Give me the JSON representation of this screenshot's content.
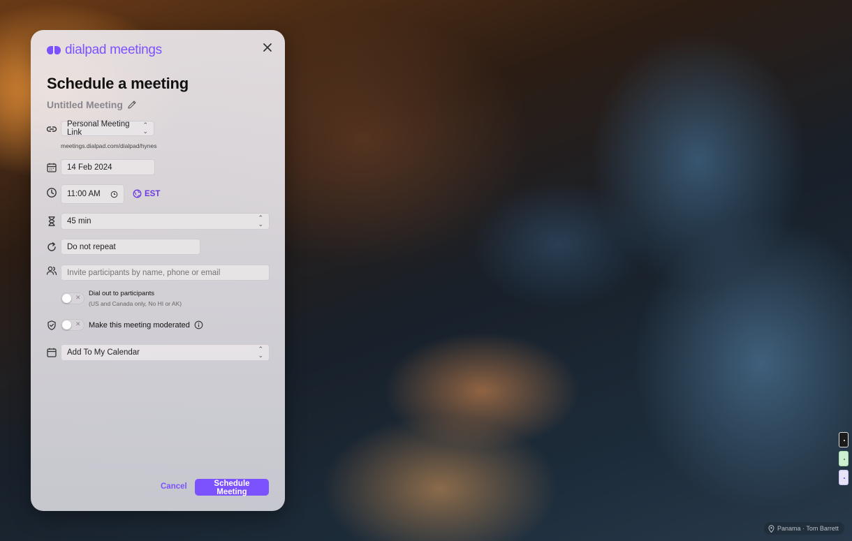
{
  "app": {
    "logo_text": "dialpad meetings",
    "accent_color": "#7c52ff"
  },
  "dialog": {
    "title": "Schedule a meeting",
    "meeting_name": "Untitled Meeting",
    "link_select": "Personal Meeting Link",
    "link_url": "meetings.dialpad.com/dialpad/hynes",
    "date": "14 Feb 2024",
    "time": "11:00 AM",
    "timezone": "EST",
    "duration": "45 min",
    "repeat": "Do not repeat",
    "participants_placeholder": "Invite participants by name, phone or email",
    "dial_out_label": "Dial out to participants",
    "dial_out_note": "(US and Canada only, No HI or AK)",
    "dial_out_enabled": false,
    "moderated_label": "Make this meeting moderated",
    "moderated_enabled": false,
    "calendar_select": "Add To My Calendar",
    "cancel_label": "Cancel",
    "schedule_label": "Schedule Meeting"
  },
  "background": {
    "credit": "Panama · Tom Barrett"
  },
  "icons": [
    "dialpad-logo-icon",
    "close-icon",
    "pencil-icon",
    "link-icon",
    "calendar-icon",
    "clock-icon",
    "globe-icon",
    "hourglass-icon",
    "repeat-icon",
    "participants-icon",
    "shield-icon",
    "info-icon",
    "location-pin-icon"
  ]
}
